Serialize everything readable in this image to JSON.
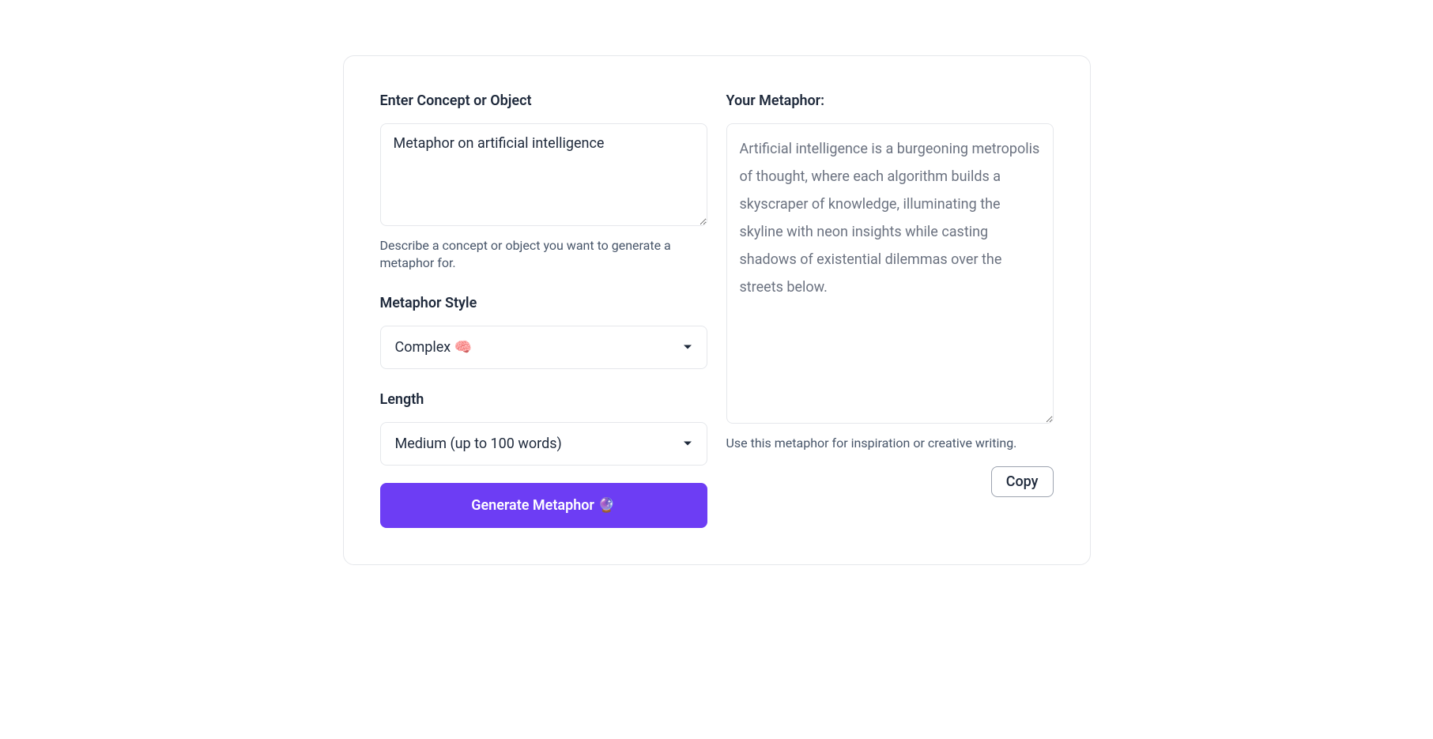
{
  "left": {
    "concept_label": "Enter Concept or Object",
    "concept_value": "Metaphor on artificial intelligence",
    "concept_help": "Describe a concept or object you want to generate a metaphor for.",
    "style_label": "Metaphor Style",
    "style_value": "Complex 🧠",
    "length_label": "Length",
    "length_value": "Medium (up to 100 words)",
    "generate_label": "Generate Metaphor 🔮"
  },
  "right": {
    "output_label": "Your Metaphor:",
    "output_value": "Artificial intelligence is a burgeoning metropolis of thought, where each algorithm builds a skyscraper of knowledge, illuminating the skyline with neon insights while casting shadows of existential dilemmas over the streets below.",
    "output_help": "Use this metaphor for inspiration or creative writing.",
    "copy_label": "Copy"
  }
}
